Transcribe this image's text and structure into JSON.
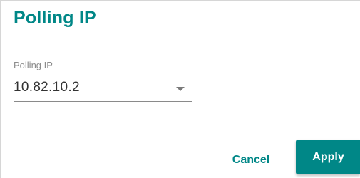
{
  "dialog": {
    "title": "Polling IP",
    "field": {
      "label": "Polling IP",
      "value": "10.82.10.2"
    },
    "actions": {
      "cancel_label": "Cancel",
      "apply_label": "Apply"
    }
  },
  "colors": {
    "accent": "#008787",
    "label": "#8c8c8c",
    "text": "#333333"
  },
  "icons": {
    "dropdown": "chevron-down-icon"
  }
}
